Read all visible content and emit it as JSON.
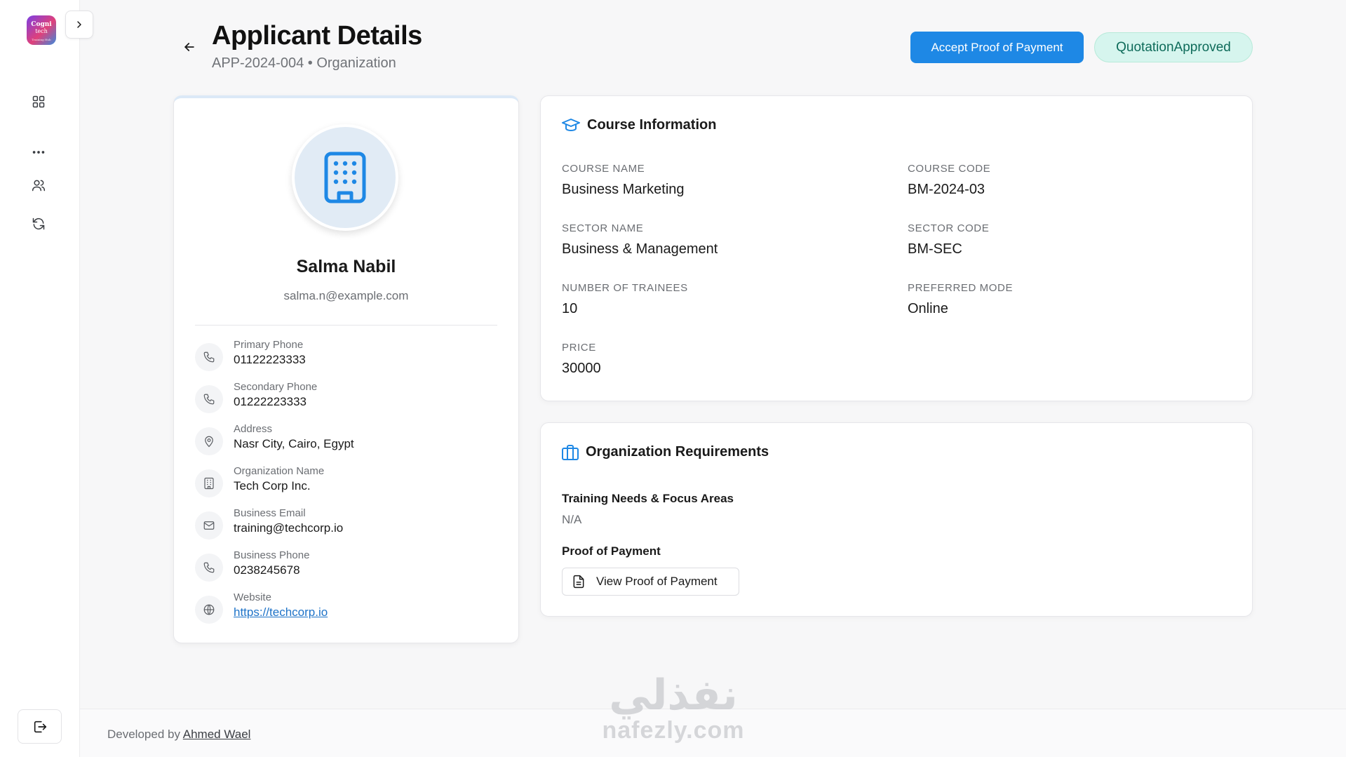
{
  "sidebar": {
    "logo": {
      "line1": "Cogni",
      "line2": "tech",
      "line3": "Training Hub"
    },
    "items": [
      "dashboard",
      "more",
      "users",
      "sync"
    ]
  },
  "header": {
    "title": "Applicant Details",
    "subtitle": "APP-2024-004 • Organization",
    "accept_label": "Accept Proof of Payment",
    "status": "QuotationApproved"
  },
  "profile": {
    "name": "Salma Nabil",
    "email": "salma.n@example.com",
    "contacts": [
      {
        "label": "Primary Phone",
        "value": "01122223333",
        "icon": "phone-icon"
      },
      {
        "label": "Secondary Phone",
        "value": "01222223333",
        "icon": "phone-icon"
      },
      {
        "label": "Address",
        "value": "Nasr City, Cairo, Egypt",
        "icon": "map-pin-icon"
      },
      {
        "label": "Organization Name",
        "value": "Tech Corp Inc.",
        "icon": "building-icon"
      },
      {
        "label": "Business Email",
        "value": "training@techcorp.io",
        "icon": "mail-icon"
      },
      {
        "label": "Business Phone",
        "value": "0238245678",
        "icon": "phone-icon"
      },
      {
        "label": "Website",
        "value": "https://techcorp.io",
        "icon": "globe-icon"
      }
    ]
  },
  "course": {
    "title": "Course Information",
    "course_name_label": "COURSE NAME",
    "course_name": "Business Marketing",
    "course_code_label": "COURSE CODE",
    "course_code": "BM-2024-03",
    "sector_name_label": "SECTOR NAME",
    "sector_name": "Business & Management",
    "sector_code_label": "SECTOR CODE",
    "sector_code": "BM-SEC",
    "trainees_label": "NUMBER OF TRAINEES",
    "trainees": "10",
    "mode_label": "PREFERRED MODE",
    "mode": "Online",
    "price_label": "PRICE",
    "price": "30000"
  },
  "requirements": {
    "title": "Organization Requirements",
    "needs_label": "Training Needs & Focus Areas",
    "needs_value": "N/A",
    "proof_label": "Proof of Payment",
    "proof_button": "View Proof of Payment"
  },
  "footer": {
    "prefix": "Developed by",
    "author": "Ahmed Wael"
  },
  "watermark": {
    "arabic": "نفذلي",
    "latin": "nafezly.com"
  },
  "colors": {
    "accent": "#1e88e5",
    "status_bg": "#d6f5ee",
    "status_text": "#0e6b5a"
  }
}
